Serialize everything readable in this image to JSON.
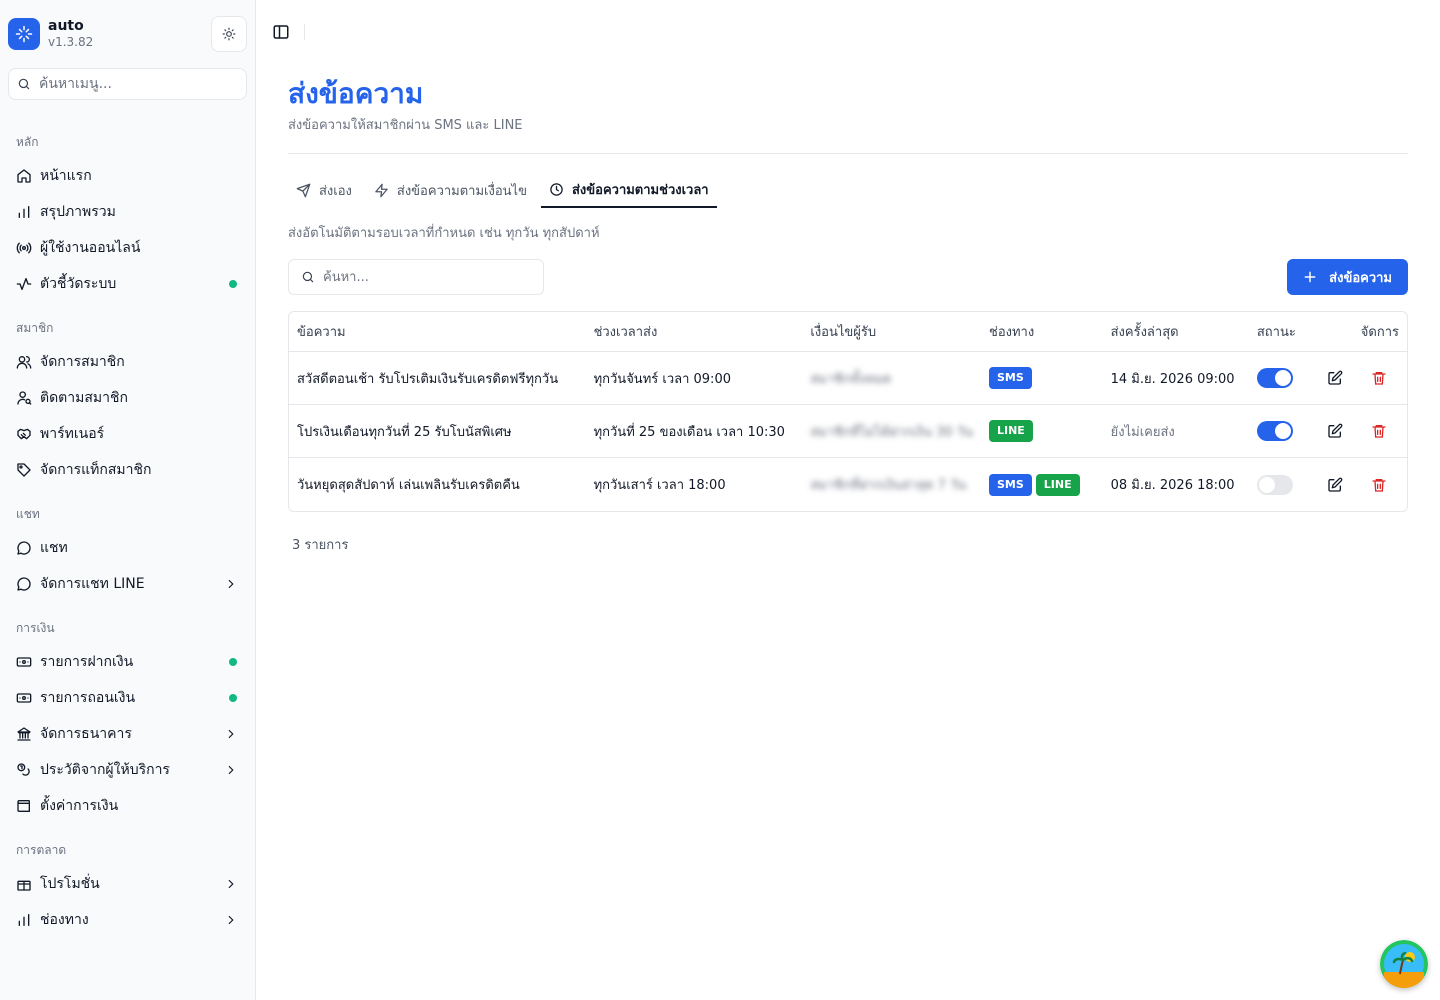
{
  "app": {
    "name": "auto",
    "version": "v1.3.82"
  },
  "sidebar": {
    "search_placeholder": "ค้นหาเมนู...",
    "groups": [
      {
        "label": "หลัก",
        "items": [
          {
            "label": "หน้าแรก",
            "icon": "home-icon"
          },
          {
            "label": "สรุปภาพรวม",
            "icon": "bar-chart-icon"
          },
          {
            "label": "ผู้ใช้งานออนไลน์",
            "icon": "radio-icon"
          },
          {
            "label": "ตัวชี้วัดระบบ",
            "icon": "activity-icon",
            "status_dot": true
          }
        ]
      },
      {
        "label": "สมาชิก",
        "items": [
          {
            "label": "จัดการสมาชิก",
            "icon": "users-icon"
          },
          {
            "label": "ติดตามสมาชิก",
            "icon": "user-search-icon"
          },
          {
            "label": "พาร์ทเนอร์",
            "icon": "handshake-icon"
          },
          {
            "label": "จัดการแท็กสมาชิก",
            "icon": "tag-icon"
          }
        ]
      },
      {
        "label": "แชท",
        "items": [
          {
            "label": "แชท",
            "icon": "chat-icon"
          },
          {
            "label": "จัดการแชท LINE",
            "icon": "chat-icon",
            "submenu": true
          }
        ]
      },
      {
        "label": "การเงิน",
        "items": [
          {
            "label": "รายการฝากเงิน",
            "icon": "deposit-icon",
            "status_dot": true
          },
          {
            "label": "รายการถอนเงิน",
            "icon": "withdraw-icon",
            "status_dot": true
          },
          {
            "label": "จัดการธนาคาร",
            "icon": "bank-icon",
            "submenu": true
          },
          {
            "label": "ประวัติจากผู้ให้บริการ",
            "icon": "coins-icon",
            "submenu": true
          },
          {
            "label": "ตั้งค่าการเงิน",
            "icon": "wallet-icon"
          }
        ]
      },
      {
        "label": "การตลาด",
        "items": [
          {
            "label": "โปรโมชั่น",
            "icon": "gift-icon",
            "submenu": true
          },
          {
            "label": "ช่องทาง",
            "icon": "bar-chart-icon",
            "submenu": true
          }
        ]
      }
    ]
  },
  "page": {
    "title": "ส่งข้อความ",
    "subtitle": "ส่งข้อความให้สมาชิกผ่าน SMS และ LINE",
    "tabs": [
      {
        "label": "ส่งเอง",
        "icon": "send-icon"
      },
      {
        "label": "ส่งข้อความตามเงื่อนไข",
        "icon": "zap-icon"
      },
      {
        "label": "ส่งข้อความตามช่วงเวลา",
        "icon": "clock-icon",
        "active": true
      }
    ],
    "tab_description": "ส่งอัตโนมัติตามรอบเวลาที่กำหนด เช่น ทุกวัน ทุกสัปดาห์",
    "search_placeholder": "ค้นหา...",
    "add_button": "ส่งข้อความ",
    "table": {
      "columns": [
        "ข้อความ",
        "ช่วงเวลาส่ง",
        "เงื่อนไขผู้รับ",
        "ช่องทาง",
        "ส่งครั้งล่าสุด",
        "สถานะ",
        "จัดการ"
      ],
      "rows": [
        {
          "message": "สวัสดีตอนเช้า รับโปรเติมเงินรับเครดิตฟรีทุกวัน",
          "schedule": "ทุกวันจันทร์ เวลา 09:00",
          "condition": "สมาชิกทั้งหมด",
          "channels": [
            "SMS"
          ],
          "last_sent": "14 มิ.ย. 2026 09:00",
          "enabled": true
        },
        {
          "message": "โปรเงินเดือนทุกวันที่ 25 รับโบนัสพิเศษ",
          "schedule": "ทุกวันที่ 25 ของเดือน เวลา 10:30",
          "condition": "สมาชิกที่ไม่ได้ฝากเงิน 30 วัน",
          "channels": [
            "LINE"
          ],
          "last_sent": "ยังไม่เคยส่ง",
          "enabled": true
        },
        {
          "message": "วันหยุดสุดสัปดาห์ เล่นเพลินรับเครดิตคืน",
          "schedule": "ทุกวันเสาร์ เวลา 18:00",
          "condition": "สมาชิกที่ฝากเงินล่าสุด 7 วัน",
          "channels": [
            "SMS",
            "LINE"
          ],
          "last_sent": "08 มิ.ย. 2026 18:00",
          "enabled": false
        }
      ]
    },
    "count_text": "3 รายการ"
  }
}
